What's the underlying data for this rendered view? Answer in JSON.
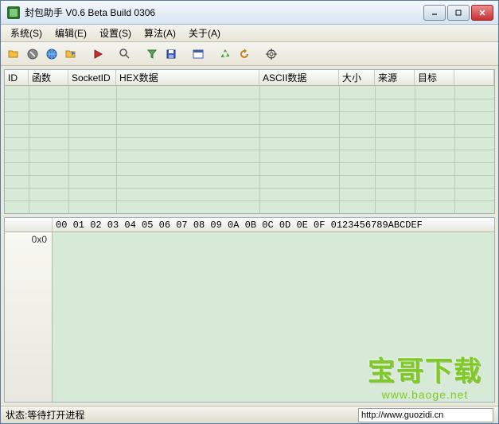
{
  "window": {
    "title": "封包助手 V0.6 Beta Build 0306"
  },
  "menu": {
    "system": "系统(S)",
    "edit": "编辑(E)",
    "settings": "设置(S)",
    "algorithm": "算法(A)",
    "about": "关于(A)"
  },
  "columns": {
    "id": "ID",
    "func": "函数",
    "socketid": "SocketID",
    "hex": "HEX数据",
    "ascii": "ASCII数据",
    "size": "大小",
    "source": "来源",
    "target": "目标"
  },
  "hex": {
    "ruler": "00 01 02 03 04 05 06 07 08 09 0A 0B 0C 0D 0E 0F  0123456789ABCDEF",
    "addr0": "0x0"
  },
  "status": {
    "text": "状态:等待打开进程",
    "url": "http://www.guozidi.cn"
  },
  "watermark": {
    "line1": "宝哥下载",
    "line2": "www.baoge.net"
  }
}
